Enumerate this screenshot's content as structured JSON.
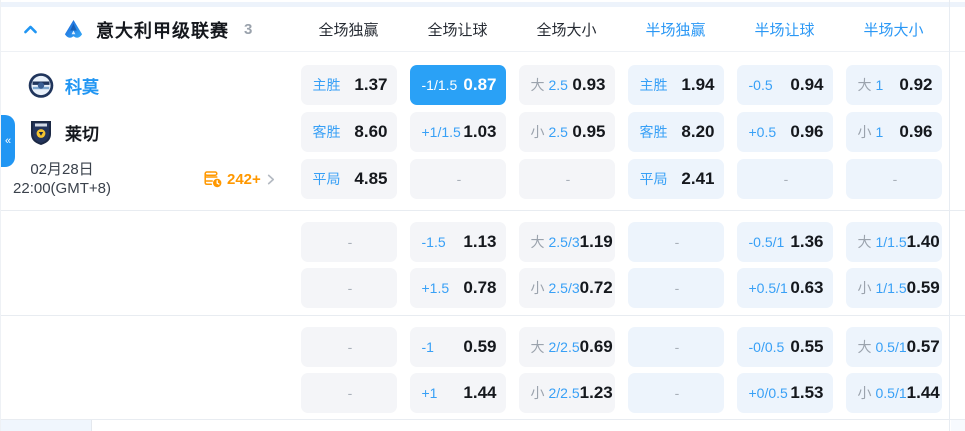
{
  "colors": {
    "accent": "#2196f3",
    "selected_bg": "#2aa1f6",
    "markets_orange": "#ff9800"
  },
  "league_header": {
    "title": "意大利甲级联赛",
    "count": "3",
    "columns": [
      {
        "label": "全场独赢",
        "period": "full"
      },
      {
        "label": "全场让球",
        "period": "full"
      },
      {
        "label": "全场大小",
        "period": "full"
      },
      {
        "label": "半场独赢",
        "period": "half"
      },
      {
        "label": "半场让球",
        "period": "half"
      },
      {
        "label": "半场大小",
        "period": "half"
      }
    ]
  },
  "match": {
    "home_team": "科莫",
    "away_team": "莱切",
    "date": "02月28日",
    "time": "22:00(GMT+8)",
    "markets_count": "242+",
    "collapse_tab": "«"
  },
  "odds": {
    "dash": "-",
    "sections": [
      {
        "rows": [
          [
            {
              "label": "主胜",
              "value": "1.37"
            },
            {
              "label": "-1/1.5",
              "value": "0.87",
              "selected": true
            },
            {
              "prefix": "大",
              "label": "2.5",
              "value": "0.93"
            },
            {
              "label": "主胜",
              "value": "1.94"
            },
            {
              "label": "-0.5",
              "value": "0.94"
            },
            {
              "prefix": "大",
              "label": "1",
              "value": "0.92"
            }
          ],
          [
            {
              "label": "客胜",
              "value": "8.60"
            },
            {
              "label": "+1/1.5",
              "value": "1.03"
            },
            {
              "prefix": "小",
              "label": "2.5",
              "value": "0.95"
            },
            {
              "label": "客胜",
              "value": "8.20"
            },
            {
              "label": "+0.5",
              "value": "0.96"
            },
            {
              "prefix": "小",
              "label": "1",
              "value": "0.96"
            }
          ],
          [
            {
              "label": "平局",
              "value": "4.85"
            },
            {
              "dash": true
            },
            {
              "dash": true
            },
            {
              "label": "平局",
              "value": "2.41"
            },
            {
              "dash": true
            },
            {
              "dash": true
            }
          ]
        ]
      },
      {
        "rows": [
          [
            {
              "dash": true
            },
            {
              "label": "-1.5",
              "value": "1.13"
            },
            {
              "prefix": "大",
              "label": "2.5/3",
              "value": "1.19"
            },
            {
              "dash": true
            },
            {
              "label": "-0.5/1",
              "value": "1.36"
            },
            {
              "prefix": "大",
              "label": "1/1.5",
              "value": "1.40"
            }
          ],
          [
            {
              "dash": true
            },
            {
              "label": "+1.5",
              "value": "0.78"
            },
            {
              "prefix": "小",
              "label": "2.5/3",
              "value": "0.72"
            },
            {
              "dash": true
            },
            {
              "label": "+0.5/1",
              "value": "0.63"
            },
            {
              "prefix": "小",
              "label": "1/1.5",
              "value": "0.59"
            }
          ]
        ]
      },
      {
        "rows": [
          [
            {
              "dash": true
            },
            {
              "label": "-1",
              "value": "0.59"
            },
            {
              "prefix": "大",
              "label": "2/2.5",
              "value": "0.69"
            },
            {
              "dash": true
            },
            {
              "label": "-0/0.5",
              "value": "0.55"
            },
            {
              "prefix": "大",
              "label": "0.5/1",
              "value": "0.57"
            }
          ],
          [
            {
              "dash": true
            },
            {
              "label": "+1",
              "value": "1.44"
            },
            {
              "prefix": "小",
              "label": "2/2.5",
              "value": "1.23"
            },
            {
              "dash": true
            },
            {
              "label": "+0/0.5",
              "value": "1.53"
            },
            {
              "prefix": "小",
              "label": "0.5/1",
              "value": "1.44"
            }
          ]
        ]
      }
    ]
  }
}
